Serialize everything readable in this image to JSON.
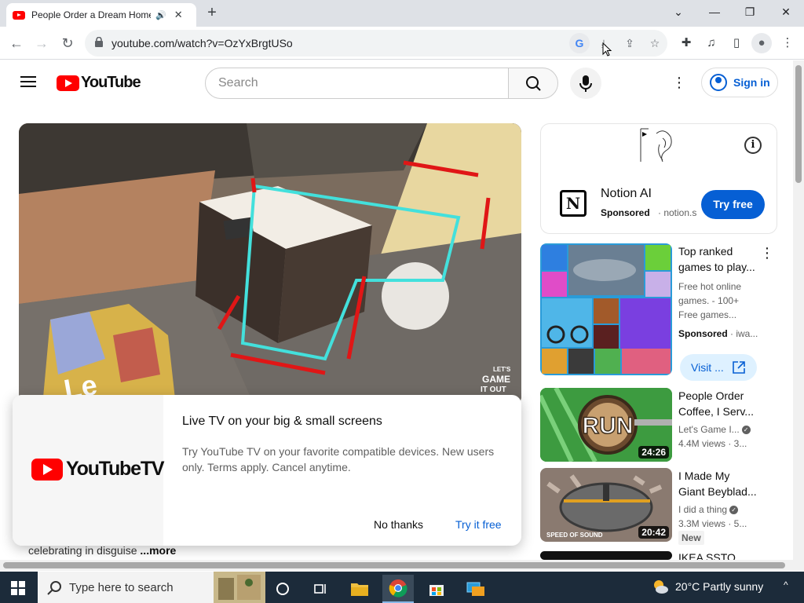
{
  "browser": {
    "tab_title": "People Order a Dream Home",
    "audio_icon": "🔊",
    "close_icon": "✕",
    "new_tab": "+",
    "window_controls": {
      "chevron": "⌄",
      "minimize": "—",
      "restore": "❐",
      "close": "✕"
    },
    "url": "youtube.com/watch?v=OzYxBrgtUSo",
    "nav": {
      "back": "←",
      "forward": "→",
      "reload": "↻"
    },
    "omni_icons": {
      "google": "G",
      "install": "⤓",
      "share": "⇪",
      "bookmark": "☆"
    },
    "toolbar_icons": {
      "extensions": "✚",
      "media": "♫",
      "sidebar": "▯",
      "profile": "●",
      "menu": "⋮"
    }
  },
  "youtube": {
    "logo_text": "YouTube",
    "search_placeholder": "Search",
    "more": "⋮",
    "sign_in": "Sign in"
  },
  "popup": {
    "brand": "YouTubeTV",
    "title": "Live TV on your big & small screens",
    "body": "Try YouTube TV on your favorite compatible devices. New users only. Terms apply. Cancel anytime.",
    "decline": "No thanks",
    "accept": "Try it free"
  },
  "description": {
    "text": "celebrating in disguise",
    "more": "...more"
  },
  "sidebar": {
    "ad": {
      "advertiser": "Notion AI",
      "sponsored": "Sponsored",
      "domain": "· notion.s",
      "cta": "Try free",
      "logo": "N",
      "info": "i"
    },
    "game_ad": {
      "title_line1": "Top ranked",
      "title_line2": "games to play...",
      "desc_line1": "Free hot online",
      "desc_line2": "games. - 100+",
      "desc_line3": "Free games...",
      "sponsored": "Sponsored",
      "domain": "· iwa...",
      "cta": "Visit ...",
      "menu": "⋮"
    },
    "videos": [
      {
        "title_line1": "People Order",
        "title_line2": "Coffee, I Serv...",
        "channel": "Let's Game I...",
        "stats": "4.4M views  · 3...",
        "duration": "24:26",
        "thumb_text": "RUN"
      },
      {
        "title_line1": "I Made My",
        "title_line2": "Giant Beyblad...",
        "channel": "I did a thing",
        "stats": "3.3M views  · 5...",
        "duration": "20:42",
        "badge": "New",
        "thumb_text": "SPEED OF SOUND"
      },
      {
        "title_line1": "IKEA SSTO"
      }
    ]
  },
  "video_overlay": {
    "watermark_line1": "LET'S",
    "watermark_line2": "GAME",
    "watermark_line3": "IT OUT",
    "floor_text": "Le"
  },
  "taskbar": {
    "search_placeholder": "Type here to search",
    "weather": "20°C  Partly sunny",
    "tray_arrow": "^"
  },
  "colors": {
    "youtube_red": "#ff0000",
    "link_blue": "#065fd4",
    "taskbar": "#1c2b3a"
  }
}
